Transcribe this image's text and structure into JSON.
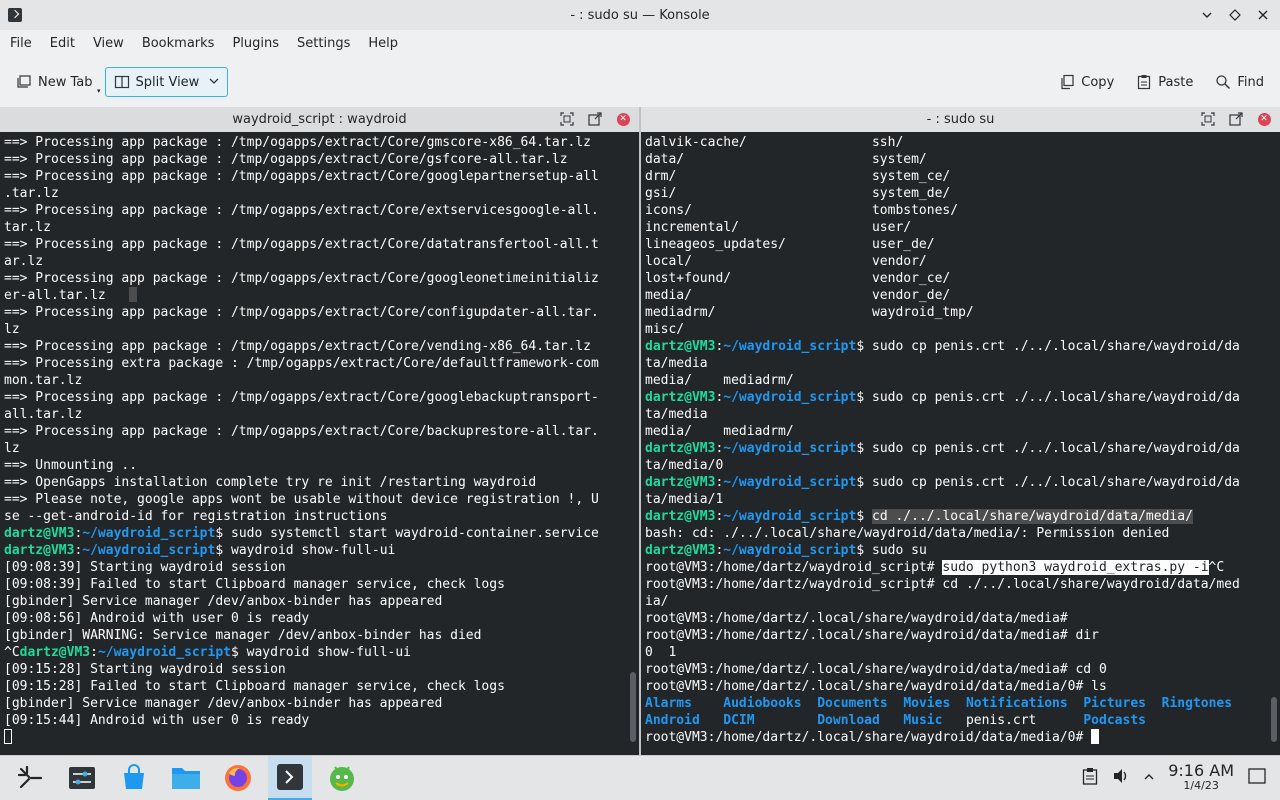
{
  "window": {
    "title": "- : sudo su — Konsole",
    "controls": [
      "minimize",
      "keep-above",
      "close"
    ]
  },
  "menubar": [
    "File",
    "Edit",
    "View",
    "Bookmarks",
    "Plugins",
    "Settings",
    "Help"
  ],
  "toolbar": {
    "new_tab": "New Tab",
    "split_view": "Split View",
    "copy": "Copy",
    "paste": "Paste",
    "find": "Find"
  },
  "left_pane": {
    "title": "waydroid_script : waydroid",
    "lines": [
      [
        {
          "t": "==> Processing app package : /tmp/ogapps/extract/Core/gmscore-x86_64.tar.lz"
        }
      ],
      [
        {
          "t": "==> Processing app package : /tmp/ogapps/extract/Core/gsfcore-all.tar.lz"
        }
      ],
      [
        {
          "t": "==> Processing app package : /tmp/ogapps/extract/Core/googlepartnersetup-all"
        }
      ],
      [
        {
          "t": ".tar.lz"
        }
      ],
      [
        {
          "t": "==> Processing app package : /tmp/ogapps/extract/Core/extservicesgoogle-all."
        }
      ],
      [
        {
          "t": "tar.lz"
        }
      ],
      [
        {
          "t": "==> Processing app package : /tmp/ogapps/extract/Core/datatransfertool-all.t"
        }
      ],
      [
        {
          "t": "ar.lz"
        }
      ],
      [
        {
          "t": "==> Processing app package : /tmp/ogapps/extract/Core/googleonetimeinitializ"
        }
      ],
      [
        {
          "t": "er-all.tar.lz   "
        },
        {
          "t": " ",
          "c": "ghost"
        }
      ],
      [
        {
          "t": "==> Processing app package : /tmp/ogapps/extract/Core/configupdater-all.tar."
        }
      ],
      [
        {
          "t": "lz"
        }
      ],
      [
        {
          "t": "==> Processing app package : /tmp/ogapps/extract/Core/vending-x86_64.tar.lz"
        }
      ],
      [
        {
          "t": "==> Processing extra package : /tmp/ogapps/extract/Core/defaultframework-com"
        }
      ],
      [
        {
          "t": "mon.tar.lz"
        }
      ],
      [
        {
          "t": "==> Processing app package : /tmp/ogapps/extract/Core/googlebackuptransport-"
        }
      ],
      [
        {
          "t": "all.tar.lz"
        }
      ],
      [
        {
          "t": "==> Processing app package : /tmp/ogapps/extract/Core/backuprestore-all.tar."
        }
      ],
      [
        {
          "t": "lz"
        }
      ],
      [
        {
          "t": "==> Unmounting .."
        }
      ],
      [
        {
          "t": "==> OpenGapps installation complete try re init /restarting waydroid"
        }
      ],
      [
        {
          "t": "==> Please note, google apps wont be usable without device registration !, U"
        }
      ],
      [
        {
          "t": "se --get-android-id for registration instructions"
        }
      ],
      [
        {
          "t": "dartz@VM3",
          "c": "prompt-user"
        },
        {
          "t": ":"
        },
        {
          "t": "~/waydroid_script",
          "c": "prompt-path"
        },
        {
          "t": "$ sudo systemctl start waydroid-container.service"
        }
      ],
      [
        {
          "t": "dartz@VM3",
          "c": "prompt-user"
        },
        {
          "t": ":"
        },
        {
          "t": "~/waydroid_script",
          "c": "prompt-path"
        },
        {
          "t": "$ waydroid show-full-ui"
        }
      ],
      [
        {
          "t": "[09:08:39] Starting waydroid session"
        }
      ],
      [
        {
          "t": "[09:08:39] Failed to start Clipboard manager service, check logs"
        }
      ],
      [
        {
          "t": "[gbinder] Service manager /dev/anbox-binder has appeared"
        }
      ],
      [
        {
          "t": "[09:08:56] Android with user 0 is ready"
        }
      ],
      [
        {
          "t": "[gbinder] WARNING: Service manager /dev/anbox-binder has died"
        }
      ],
      [
        {
          "t": "^C"
        },
        {
          "t": "dartz@VM3",
          "c": "prompt-user"
        },
        {
          "t": ":"
        },
        {
          "t": "~/waydroid_script",
          "c": "prompt-path"
        },
        {
          "t": "$ waydroid show-full-ui"
        }
      ],
      [
        {
          "t": "[09:15:28] Starting waydroid session"
        }
      ],
      [
        {
          "t": "[09:15:28] Failed to start Clipboard manager service, check logs"
        }
      ],
      [
        {
          "t": "[gbinder] Service manager /dev/anbox-binder has appeared"
        }
      ],
      [
        {
          "t": "[09:15:44] Android with user 0 is ready"
        }
      ],
      [
        {
          "t": " ",
          "c": "cursor-hollow"
        }
      ]
    ]
  },
  "right_pane": {
    "title": "- : sudo su",
    "lines": [
      [
        {
          "t": "dalvik-cache/                ssh/"
        }
      ],
      [
        {
          "t": "data/                        system/"
        }
      ],
      [
        {
          "t": "drm/                         system_ce/"
        }
      ],
      [
        {
          "t": "gsi/                         system_de/"
        }
      ],
      [
        {
          "t": "icons/                       tombstones/"
        }
      ],
      [
        {
          "t": "incremental/                 user/"
        }
      ],
      [
        {
          "t": "lineageos_updates/           user_de/"
        }
      ],
      [
        {
          "t": "local/                       vendor/"
        }
      ],
      [
        {
          "t": "lost+found/                  vendor_ce/"
        }
      ],
      [
        {
          "t": "media/                       vendor_de/"
        }
      ],
      [
        {
          "t": "mediadrm/                    waydroid_tmp/"
        }
      ],
      [
        {
          "t": "misc/"
        }
      ],
      [
        {
          "t": "dartz@VM3",
          "c": "prompt-user"
        },
        {
          "t": ":"
        },
        {
          "t": "~/waydroid_script",
          "c": "prompt-path"
        },
        {
          "t": "$ sudo cp penis.crt ./../.local/share/waydroid/da"
        }
      ],
      [
        {
          "t": "ta/media"
        }
      ],
      [
        {
          "t": "media/    mediadrm/"
        }
      ],
      [
        {
          "t": "dartz@VM3",
          "c": "prompt-user"
        },
        {
          "t": ":"
        },
        {
          "t": "~/waydroid_script",
          "c": "prompt-path"
        },
        {
          "t": "$ sudo cp penis.crt ./../.local/share/waydroid/da"
        }
      ],
      [
        {
          "t": "ta/media"
        }
      ],
      [
        {
          "t": "media/    mediadrm/"
        }
      ],
      [
        {
          "t": "dartz@VM3",
          "c": "prompt-user"
        },
        {
          "t": ":"
        },
        {
          "t": "~/waydroid_script",
          "c": "prompt-path"
        },
        {
          "t": "$ sudo cp penis.crt ./../.local/share/waydroid/da"
        }
      ],
      [
        {
          "t": "ta/media/0"
        }
      ],
      [
        {
          "t": "dartz@VM3",
          "c": "prompt-user"
        },
        {
          "t": ":"
        },
        {
          "t": "~/waydroid_script",
          "c": "prompt-path"
        },
        {
          "t": "$ sudo cp penis.crt ./../.local/share/waydroid/da"
        }
      ],
      [
        {
          "t": "ta/media/1"
        }
      ],
      [
        {
          "t": "dartz@VM3",
          "c": "prompt-user"
        },
        {
          "t": ":"
        },
        {
          "t": "~/waydroid_script",
          "c": "prompt-path"
        },
        {
          "t": "$ "
        },
        {
          "t": "cd ./../.local/share/waydroid/data/media/",
          "c": "hl"
        }
      ],
      [
        {
          "t": "bash: cd: ./../.local/share/waydroid/data/media/: Permission denied"
        }
      ],
      [
        {
          "t": "dartz@VM3",
          "c": "prompt-user"
        },
        {
          "t": ":"
        },
        {
          "t": "~/waydroid_script",
          "c": "prompt-path"
        },
        {
          "t": "$ sudo su"
        }
      ],
      [
        {
          "t": "root@VM3:/home/dartz/waydroid_script# "
        },
        {
          "t": "sudo python3 waydroid_extras.py -i",
          "c": "sel"
        },
        {
          "t": "^C"
        }
      ],
      [
        {
          "t": "root@VM3:/home/dartz/waydroid_script# cd ./../.local/share/waydroid/data/med"
        }
      ],
      [
        {
          "t": "ia/"
        }
      ],
      [
        {
          "t": "root@VM3:/home/dartz/.local/share/waydroid/data/media#"
        }
      ],
      [
        {
          "t": "root@VM3:/home/dartz/.local/share/waydroid/data/media# dir"
        }
      ],
      [
        {
          "t": "0  1"
        }
      ],
      [
        {
          "t": "root@VM3:/home/dartz/.local/share/waydroid/data/media# cd 0"
        }
      ],
      [
        {
          "t": "root@VM3:/home/dartz/.local/share/waydroid/data/media/0# ls"
        }
      ],
      [
        {
          "t": "Alarms",
          "c": "dirblue"
        },
        {
          "t": "    "
        },
        {
          "t": "Audiobooks",
          "c": "dirblue"
        },
        {
          "t": "  "
        },
        {
          "t": "Documents",
          "c": "dirblue"
        },
        {
          "t": "  "
        },
        {
          "t": "Movies",
          "c": "dirblue"
        },
        {
          "t": "  "
        },
        {
          "t": "Notifications",
          "c": "dirblue"
        },
        {
          "t": "  "
        },
        {
          "t": "Pictures",
          "c": "dirblue"
        },
        {
          "t": "  "
        },
        {
          "t": "Ringtones",
          "c": "dirblue"
        }
      ],
      [
        {
          "t": "Android",
          "c": "dirblue"
        },
        {
          "t": "   "
        },
        {
          "t": "DCIM",
          "c": "dirblue"
        },
        {
          "t": "        "
        },
        {
          "t": "Download",
          "c": "dirblue"
        },
        {
          "t": "   "
        },
        {
          "t": "Music",
          "c": "dirblue"
        },
        {
          "t": "   penis.crt      "
        },
        {
          "t": "Podcasts",
          "c": "dirblue"
        }
      ],
      [
        {
          "t": "root@VM3:/home/dartz/.local/share/waydroid/data/media/0# "
        },
        {
          "t": " ",
          "c": "cursor"
        }
      ]
    ]
  },
  "taskbar": {
    "apps": [
      "application-launcher",
      "system-settings",
      "discover",
      "file-manager",
      "firefox",
      "konsole",
      "waydroid"
    ],
    "clock_time": "9:16 AM",
    "clock_date": "1/4/23"
  }
}
